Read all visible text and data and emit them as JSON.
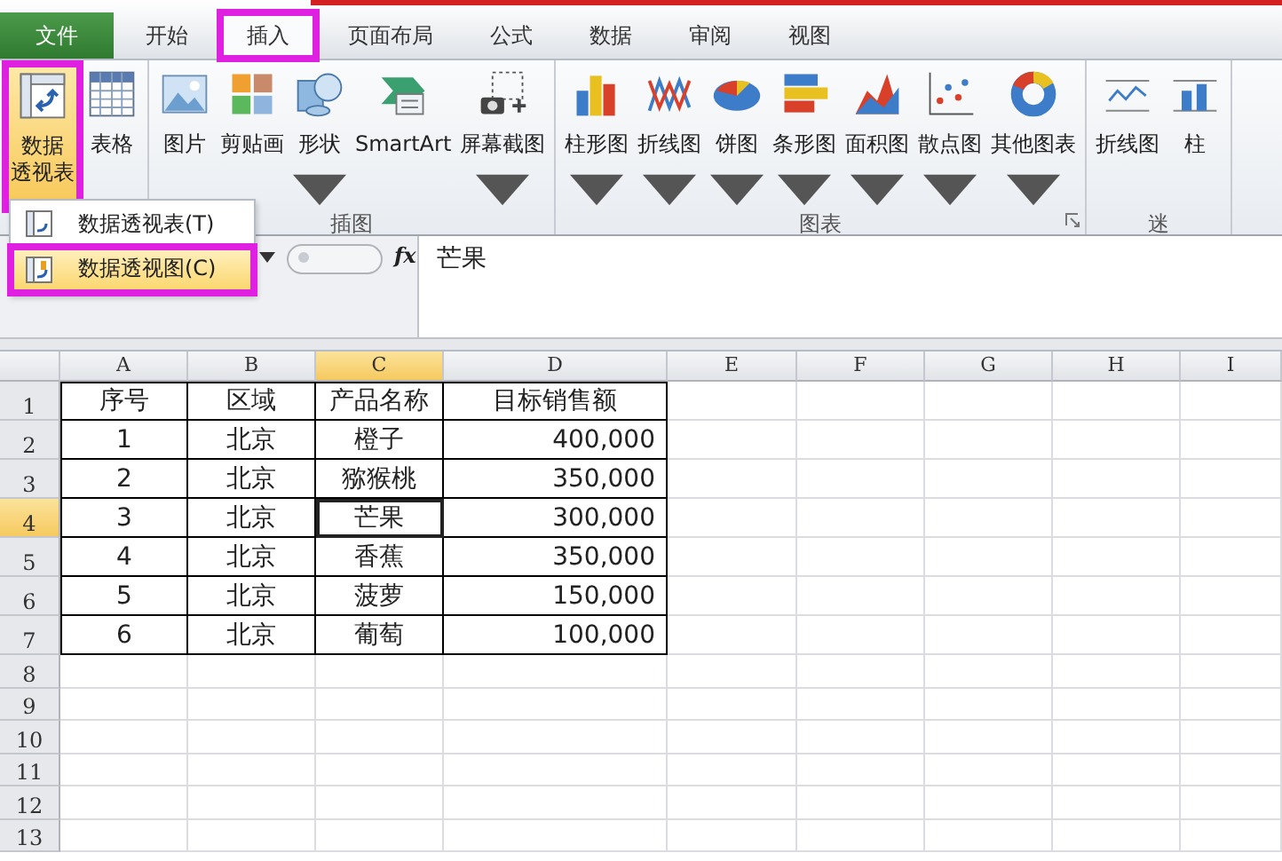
{
  "tabs": [
    {
      "label": "文件",
      "kind": "file",
      "selected": false,
      "highlighted": false
    },
    {
      "label": "开始",
      "kind": "tab",
      "selected": false,
      "highlighted": false
    },
    {
      "label": "插入",
      "kind": "tab",
      "selected": true,
      "highlighted": true
    },
    {
      "label": "页面布局",
      "kind": "tab",
      "selected": false,
      "highlighted": false
    },
    {
      "label": "公式",
      "kind": "tab",
      "selected": false,
      "highlighted": false
    },
    {
      "label": "数据",
      "kind": "tab",
      "selected": false,
      "highlighted": false
    },
    {
      "label": "审阅",
      "kind": "tab",
      "selected": false,
      "highlighted": false
    },
    {
      "label": "视图",
      "kind": "tab",
      "selected": false,
      "highlighted": false
    }
  ],
  "ribbon": {
    "groups": [
      {
        "buttons": [
          {
            "lines": [
              "数据",
              "透视表"
            ],
            "kind": "pivot",
            "dropdown": false,
            "active": true,
            "highlighted": true
          },
          {
            "lines": [
              "表格"
            ],
            "kind": "table",
            "dropdown": false,
            "active": false,
            "highlighted": false
          }
        ]
      },
      {
        "label": "插图",
        "buttons": [
          {
            "lines": [
              "图片"
            ],
            "kind": "picture",
            "dropdown": false,
            "active": false,
            "highlighted": false
          },
          {
            "lines": [
              "剪贴画"
            ],
            "kind": "clipart",
            "dropdown": false,
            "active": false,
            "highlighted": false
          },
          {
            "lines": [
              "形状"
            ],
            "kind": "shapes",
            "dropdown": true,
            "active": false,
            "highlighted": false
          },
          {
            "lines": [
              "SmartArt"
            ],
            "kind": "smartart",
            "dropdown": false,
            "active": false,
            "highlighted": false
          },
          {
            "lines": [
              "屏幕截图"
            ],
            "kind": "screenshot",
            "dropdown": true,
            "active": false,
            "highlighted": false
          }
        ]
      },
      {
        "label": "图表",
        "launcher": true,
        "buttons": [
          {
            "lines": [
              "柱形图"
            ],
            "kind": "column",
            "dropdown": true,
            "active": false,
            "highlighted": false
          },
          {
            "lines": [
              "折线图"
            ],
            "kind": "line",
            "dropdown": true,
            "active": false,
            "highlighted": false
          },
          {
            "lines": [
              "饼图"
            ],
            "kind": "pie",
            "dropdown": true,
            "active": false,
            "highlighted": false
          },
          {
            "lines": [
              "条形图"
            ],
            "kind": "bar",
            "dropdown": true,
            "active": false,
            "highlighted": false
          },
          {
            "lines": [
              "面积图"
            ],
            "kind": "area",
            "dropdown": true,
            "active": false,
            "highlighted": false
          },
          {
            "lines": [
              "散点图"
            ],
            "kind": "scatter",
            "dropdown": true,
            "active": false,
            "highlighted": false
          },
          {
            "lines": [
              "其他图表"
            ],
            "kind": "donut",
            "dropdown": true,
            "active": false,
            "highlighted": false
          }
        ]
      },
      {
        "label": "迷",
        "buttons": [
          {
            "lines": [
              "折线图"
            ],
            "kind": "sparkline",
            "dropdown": false,
            "active": false,
            "highlighted": false
          },
          {
            "lines": [
              "柱"
            ],
            "kind": "sparkcolumn",
            "dropdown": false,
            "active": false,
            "highlighted": false
          }
        ]
      }
    ]
  },
  "menu": {
    "items": [
      {
        "label": "数据透视表(T)",
        "selected": false,
        "highlighted": false
      },
      {
        "label": "数据透视图(C)",
        "selected": true,
        "highlighted": true
      }
    ]
  },
  "formula_bar": {
    "function_label": "fx",
    "content": "芒果"
  },
  "sheet": {
    "columns": [
      {
        "label": "A",
        "selected": false
      },
      {
        "label": "B",
        "selected": false
      },
      {
        "label": "C",
        "selected": true
      },
      {
        "label": "D",
        "selected": false
      },
      {
        "label": "E",
        "selected": false
      },
      {
        "label": "F",
        "selected": false
      },
      {
        "label": "G",
        "selected": false
      },
      {
        "label": "H",
        "selected": false
      },
      {
        "label": "I",
        "selected": false
      }
    ],
    "rows": [
      {
        "number": "1",
        "selected": false,
        "cells": [
          "序号",
          "区域",
          "产品名称",
          "目标销售额"
        ]
      },
      {
        "number": "2",
        "selected": false,
        "cells": [
          "1",
          "北京",
          "橙子",
          "400,000"
        ]
      },
      {
        "number": "3",
        "selected": false,
        "cells": [
          "2",
          "北京",
          "猕猴桃",
          "350,000"
        ]
      },
      {
        "number": "4",
        "selected": true,
        "cells": [
          "3",
          "北京",
          "芒果",
          "300,000"
        ],
        "active_cells": [
          false,
          false,
          true,
          false
        ]
      },
      {
        "number": "5",
        "selected": false,
        "cells": [
          "4",
          "北京",
          "香蕉",
          "350,000"
        ]
      },
      {
        "number": "6",
        "selected": false,
        "cells": [
          "5",
          "北京",
          "菠萝",
          "150,000"
        ]
      },
      {
        "number": "7",
        "selected": false,
        "cells": [
          "6",
          "北京",
          "葡萄",
          "100,000"
        ]
      },
      {
        "number": "8",
        "selected": false
      },
      {
        "number": "9",
        "selected": false
      },
      {
        "number": "10",
        "selected": false
      },
      {
        "number": "11",
        "selected": false
      },
      {
        "number": "12",
        "selected": false
      },
      {
        "number": "13",
        "selected": false
      }
    ]
  }
}
